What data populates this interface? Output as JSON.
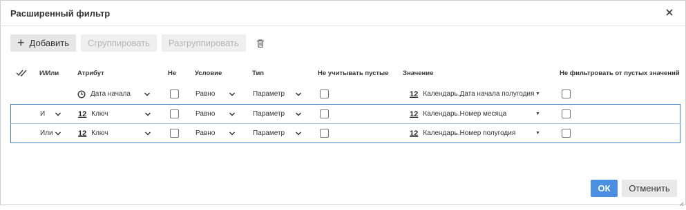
{
  "dialog": {
    "title": "Расширенный фильтр",
    "close_icon": "close-icon"
  },
  "toolbar": {
    "add_label": "Добавить",
    "group_label": "Сгруппировать",
    "ungroup_label": "Разгруппировать",
    "delete_icon": "trash-icon"
  },
  "columns": {
    "andor": "И/Или",
    "attribute": "Атрибут",
    "not": "Не",
    "condition": "Условие",
    "type": "Тип",
    "ignore_empty": "Не учитывать пустые",
    "value": "Значение",
    "no_filter_empty": "Не фильтровать от пустых значений"
  },
  "rows": [
    {
      "andor": "",
      "attribute_icon": "clock-icon",
      "attribute": "Дата начала",
      "condition": "Равно",
      "type": "Параметр",
      "value_icon": "number-icon",
      "value": "Календарь.Дата начала полугодия"
    },
    {
      "andor": "И",
      "attribute_icon": "number-icon",
      "attribute": "Ключ",
      "condition": "Равно",
      "type": "Параметр",
      "value_icon": "number-icon",
      "value": "Календарь.Номер месяца"
    },
    {
      "andor": "Или",
      "attribute_icon": "number-icon",
      "attribute": "Ключ",
      "condition": "Равно",
      "type": "Параметр",
      "value_icon": "number-icon",
      "value": "Календарь.Номер полугодия"
    }
  ],
  "number_icon_glyph": "12",
  "footer": {
    "ok_label": "ОК",
    "cancel_label": "Отменить"
  },
  "colors": {
    "primary": "#4a8fe1",
    "selected_row_border": "#3d7ec5"
  }
}
